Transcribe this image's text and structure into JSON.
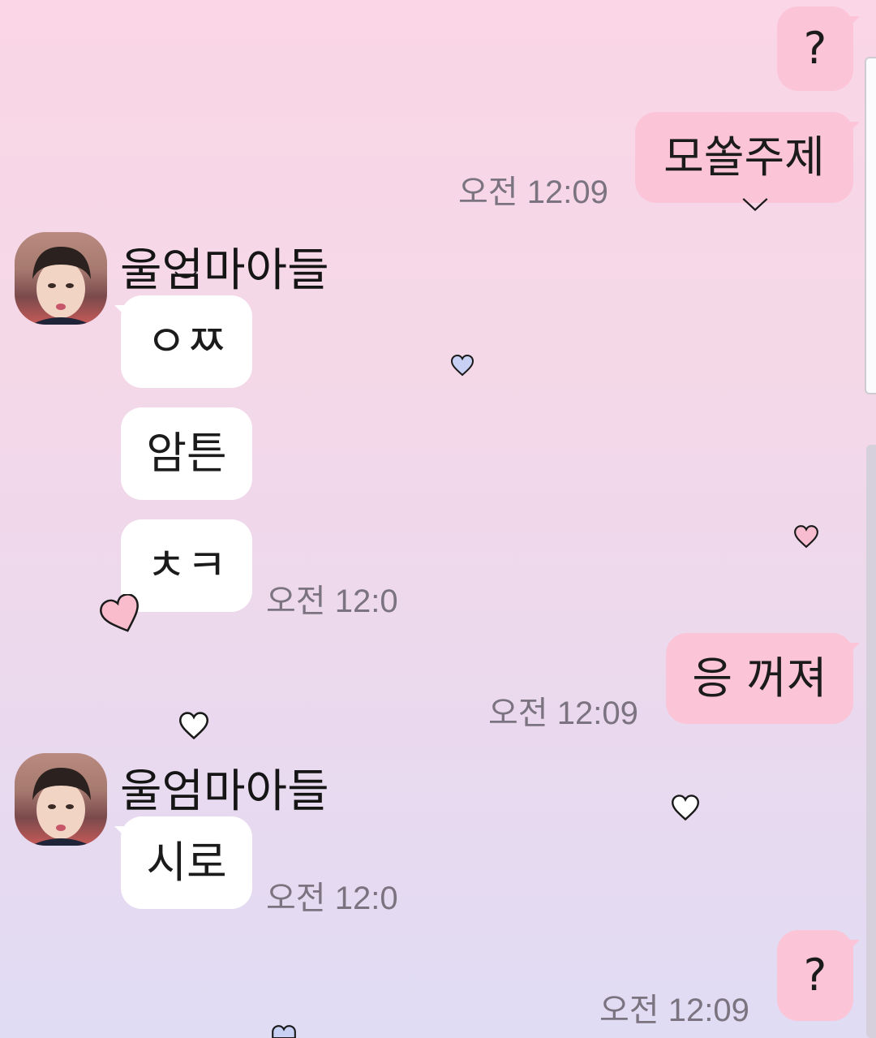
{
  "colors": {
    "my_bubble": "#fbc4d7",
    "their_bubble": "#ffffff",
    "timestamp": "#7b7480"
  },
  "messages": [
    {
      "side": "me",
      "text": "?",
      "time": ""
    },
    {
      "side": "me",
      "text": "모쏠주제",
      "time": "오전 12:09"
    },
    {
      "side": "them",
      "sender": "울엄마아들",
      "texts": [
        "ㅇㅉ",
        "암튼",
        "ㅊㅋ"
      ],
      "time": "오전 12:0"
    },
    {
      "side": "me",
      "text": "응 꺼져",
      "time": "오전 12:09"
    },
    {
      "side": "them",
      "sender": "울엄마아들",
      "texts": [
        "시로"
      ],
      "time": "오전 12:0"
    },
    {
      "side": "me",
      "text": "?",
      "time": "오전 12:09"
    }
  ],
  "icons": {
    "avatar": "profile-photo",
    "decoration": "heart-icon"
  }
}
